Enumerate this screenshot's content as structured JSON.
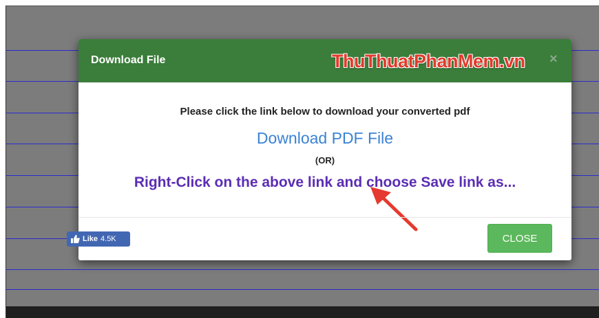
{
  "modal": {
    "title": "Download File",
    "watermark": "ThuThuatPhanMem.vn",
    "close_x": "×",
    "instruction": "Please click the link below to download your converted pdf",
    "download_link": "Download PDF File",
    "or_text": "(OR)",
    "right_click_hint": "Right-Click on the above link and choose Save link as...",
    "close_button": "CLOSE"
  },
  "like_widget": {
    "label": "Like",
    "count": "4.5K"
  },
  "colors": {
    "header_bg": "#3b7d3b",
    "close_button_bg": "#5cb85c",
    "link": "#3a82d4",
    "hint": "#5b2db3",
    "arrow": "#e53a2f",
    "backdrop": "#7c7c7c"
  },
  "icons": {
    "like": "thumbs-up-icon",
    "pointer": "red-arrow-annotation"
  }
}
